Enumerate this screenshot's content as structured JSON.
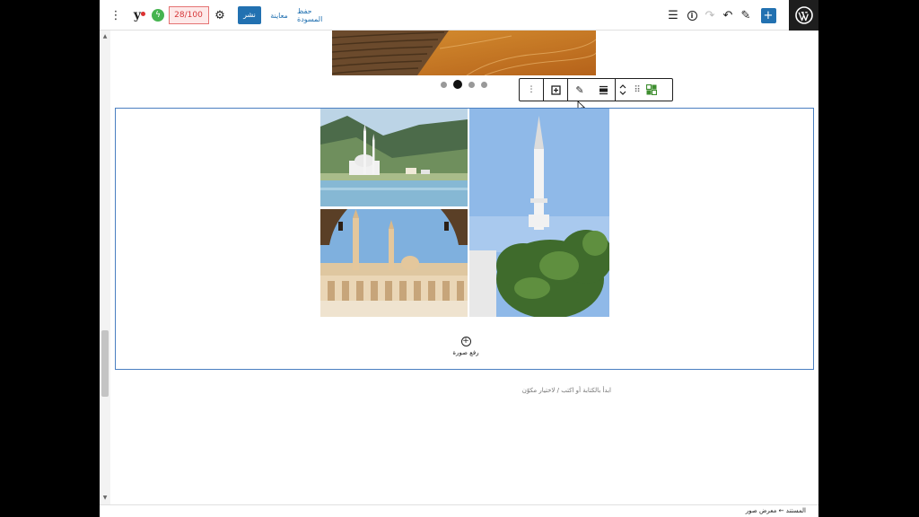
{
  "toolbar": {
    "seo_score": "28/100",
    "publish_label": "نشر",
    "preview_label": "معاينة",
    "save_draft_label": "حفظ المسودة"
  },
  "icons": {
    "more": "vertical-ellipsis-icon",
    "yoast": "yoast-icon",
    "performance": "bolt-icon",
    "settings": "gear-icon",
    "list_view": "list-view-icon",
    "details": "info-icon",
    "redo": "redo-icon",
    "undo": "undo-icon",
    "tools": "pencil-icon",
    "add_block": "plus-icon",
    "wordpress": "wordpress-logo"
  },
  "slider": {
    "dot_count": 4,
    "active_dot": 1
  },
  "gallery": {
    "upload_label": "رفع صورة"
  },
  "editor": {
    "placeholder": "ابدأ بالكتابة أو اكتب / لاختيار مكوّن"
  },
  "footer": {
    "breadcrumb": "المستند ← معرض صور"
  },
  "colors": {
    "accent": "#2271b1",
    "block_outline": "#4a7fc1",
    "score_bg": "#fde9e9",
    "score_text": "#d63638",
    "wp_bar": "#1e1e1e"
  }
}
